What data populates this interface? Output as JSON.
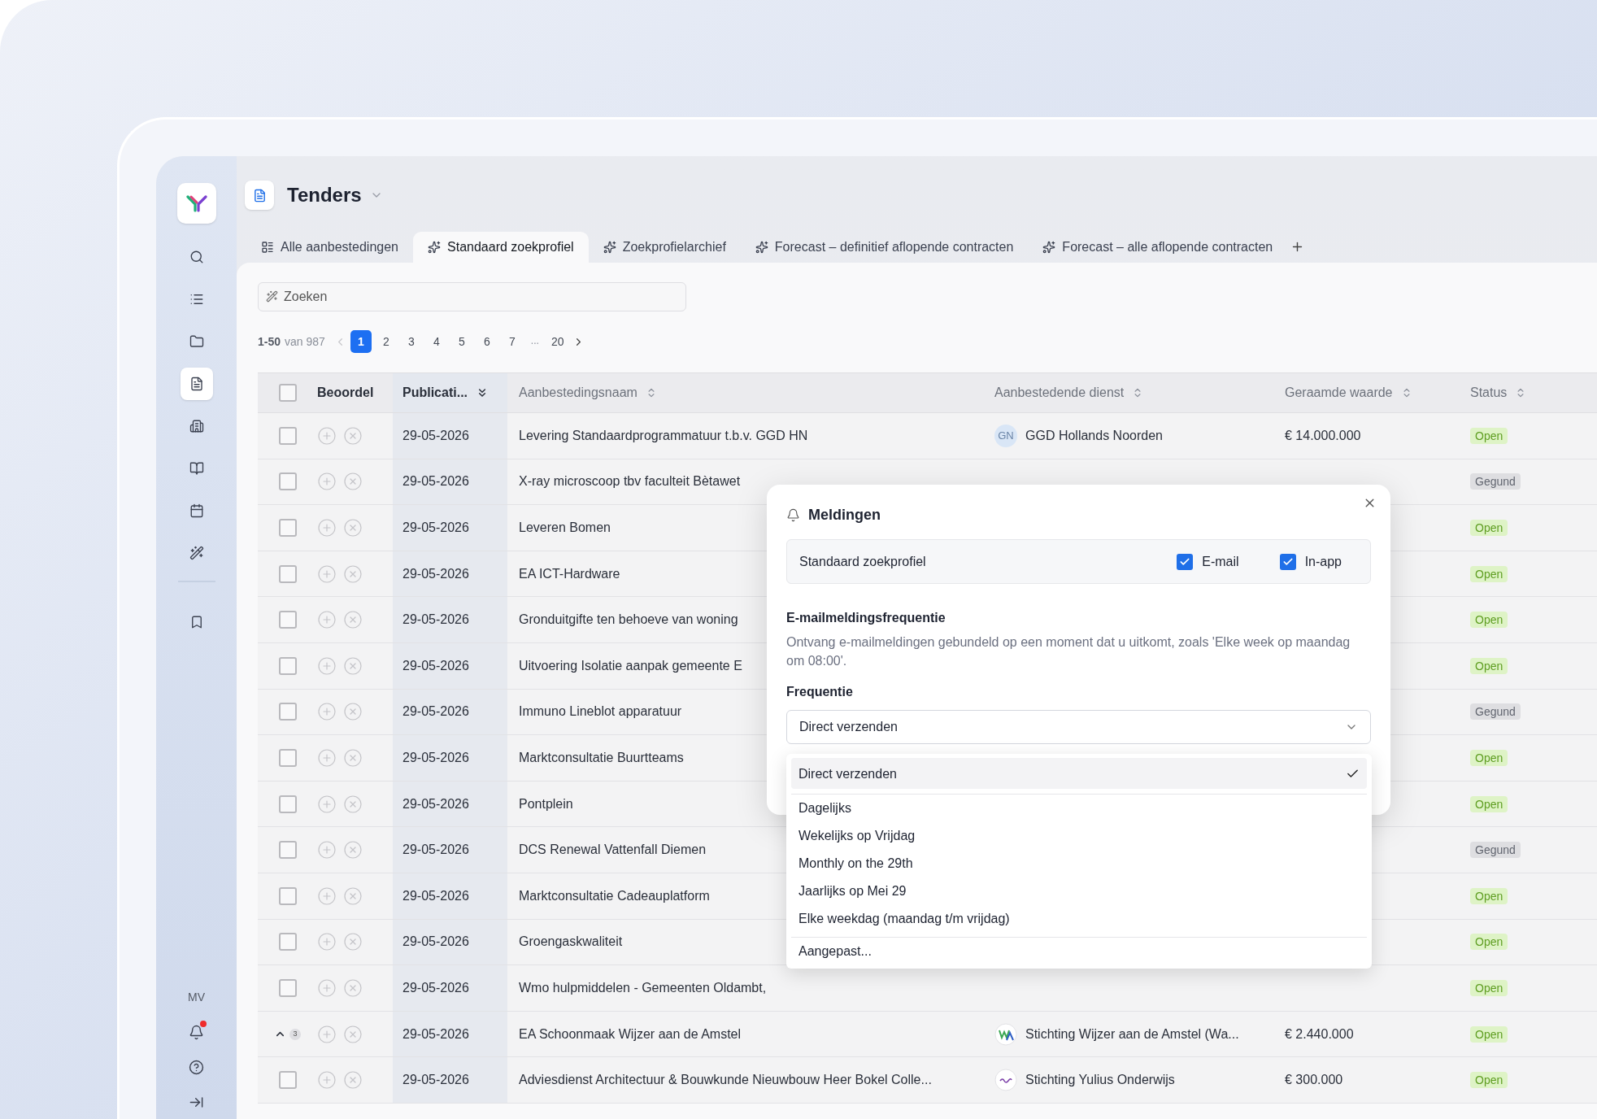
{
  "app": {
    "title": "Tenders"
  },
  "sidebar": {
    "items": [
      {
        "selected": false
      },
      {
        "selected": false
      },
      {
        "selected": false
      },
      {
        "selected": true
      },
      {
        "selected": false
      },
      {
        "selected": false
      },
      {
        "selected": false
      },
      {
        "selected": false
      },
      {
        "selected": false
      }
    ],
    "user_initials": "MV",
    "notifications": {
      "unread": true
    }
  },
  "tabs": [
    {
      "label": "Alle aanbestedingen",
      "kind": "list",
      "selected": false
    },
    {
      "label": "Standaard zoekprofiel",
      "kind": "profile",
      "selected": true
    },
    {
      "label": "Zoekprofielarchief",
      "kind": "profile",
      "selected": false
    },
    {
      "label": "Forecast – definitief aflopende contracten",
      "kind": "profile",
      "selected": false
    },
    {
      "label": "Forecast – alle aflopende contracten",
      "kind": "profile",
      "selected": false
    }
  ],
  "search": {
    "placeholder": "Zoeken"
  },
  "pagination": {
    "range": "1-50",
    "total": "van 987",
    "prev_disabled": true,
    "pages": [
      {
        "label": "1",
        "kind": "page",
        "selected": true
      },
      {
        "label": "2",
        "kind": "page",
        "selected": false
      },
      {
        "label": "3",
        "kind": "page",
        "selected": false
      },
      {
        "label": "4",
        "kind": "page",
        "selected": false
      },
      {
        "label": "5",
        "kind": "page",
        "selected": false
      },
      {
        "label": "6",
        "kind": "page",
        "selected": false
      },
      {
        "label": "7",
        "kind": "page",
        "selected": false
      },
      {
        "label": "...",
        "kind": "ellipsis",
        "selected": false
      },
      {
        "label": "20",
        "kind": "page",
        "selected": false
      }
    ]
  },
  "table": {
    "header_checked": false,
    "columns": [
      {
        "label": "Beoordel",
        "kind": "plain"
      },
      {
        "label": "Publicati...",
        "kind": "sorted"
      },
      {
        "label": "Aanbestedingsnaam",
        "kind": "sortable"
      },
      {
        "label": "Aanbestedende dienst",
        "kind": "sortable"
      },
      {
        "label": "Geraamde waarde",
        "kind": "sortable"
      },
      {
        "label": "Status",
        "kind": "sortable"
      }
    ],
    "rows": [
      {
        "select": {
          "kind": "checkbox",
          "checked": false
        },
        "date": "29-05-2026",
        "name": "Levering Standaardprogrammatuur t.b.v. GGD HN",
        "agency": {
          "avatar": {
            "kind": "initials",
            "text": "GN"
          },
          "name": "GGD Hollands Noorden"
        },
        "value": "€ 14.000.000",
        "status": {
          "label": "Open",
          "kind": "open"
        }
      },
      {
        "select": {
          "kind": "checkbox",
          "checked": false
        },
        "date": "29-05-2026",
        "name": "X-ray microscoop tbv faculteit Bètawet",
        "status": {
          "label": "Gegund",
          "kind": "awarded"
        }
      },
      {
        "select": {
          "kind": "checkbox",
          "checked": false
        },
        "date": "29-05-2026",
        "name": "Leveren Bomen",
        "status": {
          "label": "Open",
          "kind": "open"
        }
      },
      {
        "select": {
          "kind": "checkbox",
          "checked": false
        },
        "date": "29-05-2026",
        "name": "EA ICT-Hardware",
        "status": {
          "label": "Open",
          "kind": "open"
        }
      },
      {
        "select": {
          "kind": "checkbox",
          "checked": false
        },
        "date": "29-05-2026",
        "name": "Gronduitgifte ten behoeve van woning",
        "status": {
          "label": "Open",
          "kind": "open"
        }
      },
      {
        "select": {
          "kind": "checkbox",
          "checked": false
        },
        "date": "29-05-2026",
        "name": "Uitvoering Isolatie aanpak gemeente E",
        "status": {
          "label": "Open",
          "kind": "open"
        }
      },
      {
        "select": {
          "kind": "checkbox",
          "checked": false
        },
        "date": "29-05-2026",
        "name": "Immuno Lineblot apparatuur",
        "status": {
          "label": "Gegund",
          "kind": "awarded"
        }
      },
      {
        "select": {
          "kind": "checkbox",
          "checked": false
        },
        "date": "29-05-2026",
        "name": "Marktconsultatie Buurtteams",
        "status": {
          "label": "Open",
          "kind": "open"
        }
      },
      {
        "select": {
          "kind": "checkbox",
          "checked": false
        },
        "date": "29-05-2026",
        "name": "Pontplein",
        "status": {
          "label": "Open",
          "kind": "open"
        }
      },
      {
        "select": {
          "kind": "checkbox",
          "checked": false
        },
        "date": "29-05-2026",
        "name": "DCS Renewal Vattenfall Diemen",
        "status": {
          "label": "Gegund",
          "kind": "awarded"
        }
      },
      {
        "select": {
          "kind": "checkbox",
          "checked": false
        },
        "date": "29-05-2026",
        "name": "Marktconsultatie Cadeauplatform",
        "status": {
          "label": "Open",
          "kind": "open"
        }
      },
      {
        "select": {
          "kind": "checkbox",
          "checked": false
        },
        "date": "29-05-2026",
        "name": "Groengaskwaliteit",
        "status": {
          "label": "Open",
          "kind": "open"
        }
      },
      {
        "select": {
          "kind": "checkbox",
          "checked": false
        },
        "date": "29-05-2026",
        "name": "Wmo hulpmiddelen - Gemeenten Oldambt,",
        "status": {
          "label": "Open",
          "kind": "open"
        }
      },
      {
        "select": {
          "kind": "group",
          "count": "3"
        },
        "date": "29-05-2026",
        "name": "EA Schoonmaak Wijzer aan de Amstel",
        "agency": {
          "avatar": {
            "kind": "wa-logo"
          },
          "name": "Stichting Wijzer aan de Amstel (Wa..."
        },
        "value": "€ 2.440.000",
        "status": {
          "label": "Open",
          "kind": "open"
        }
      },
      {
        "select": {
          "kind": "checkbox",
          "checked": false
        },
        "date": "29-05-2026",
        "name": "Adviesdienst Architectuur & Bouwkunde Nieuwbouw Heer Bokel Colle...",
        "agency": {
          "avatar": {
            "kind": "circle-logo"
          },
          "name": "Stichting Yulius Onderwijs"
        },
        "value": "€ 300.000",
        "status": {
          "label": "Open",
          "kind": "open"
        }
      }
    ]
  },
  "dialog": {
    "title": "Meldingen",
    "profile": {
      "name": "Standaard zoekprofiel",
      "channels": [
        {
          "label": "E-mail",
          "checked": true
        },
        {
          "label": "In-app",
          "checked": true
        }
      ]
    },
    "section_title": "E-mailmeldingsfrequentie",
    "description": "Ontvang e-mailmeldingen gebundeld op een moment dat u uitkomt, zoals 'Elke week op maandag om 08:00'.",
    "frequency": {
      "label": "Frequentie",
      "value": "Direct verzenden",
      "expanded": true,
      "options": [
        {
          "label": "Direct verzenden",
          "selected": true,
          "divider_before": false
        },
        {
          "label": "Dagelijks",
          "selected": false,
          "divider_before": true
        },
        {
          "label": "Wekelijks op Vrijdag",
          "selected": false,
          "divider_before": false
        },
        {
          "label": "Monthly on the 29th",
          "selected": false,
          "divider_before": false
        },
        {
          "label": "Jaarlijks op Mei 29",
          "selected": false,
          "divider_before": false
        },
        {
          "label": "Elke weekdag (maandag t/m vrijdag)",
          "selected": false,
          "divider_before": false
        },
        {
          "label": "Aangepast...",
          "selected": false,
          "divider_before": true
        }
      ]
    }
  }
}
